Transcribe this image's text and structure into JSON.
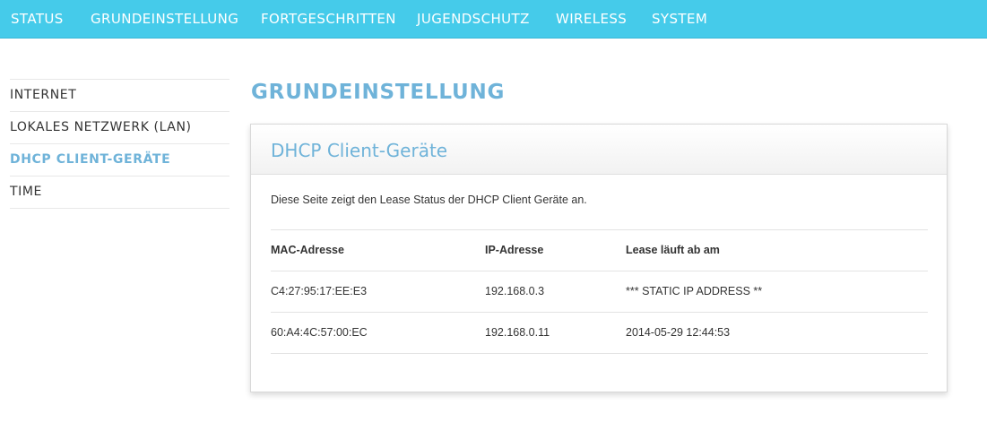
{
  "topnav": {
    "items": [
      "STATUS",
      "GRUNDEINSTELLUNG",
      "FORTGESCHRITTEN",
      "JUGENDSCHUTZ",
      "WIRELESS",
      "SYSTEM"
    ],
    "background": "#45cbea"
  },
  "sidebar": {
    "items": [
      {
        "label": "INTERNET"
      },
      {
        "label": "LOKALES NETZWERK (LAN)"
      },
      {
        "label": "DHCP CLIENT-GERÄTE",
        "active": true
      },
      {
        "label": "TIME"
      }
    ]
  },
  "page": {
    "title": "GRUNDEINSTELLUNG"
  },
  "panel": {
    "title": "DHCP Client-Geräte",
    "description": "Diese Seite zeigt den Lease Status der DHCP Client Geräte an.",
    "table": {
      "headers": [
        "MAC-Adresse",
        "IP-Adresse",
        "Lease läuft ab am"
      ],
      "rows": [
        [
          "C4:27:95:17:EE:E3",
          "192.168.0.3",
          "*** STATIC IP ADDRESS **"
        ],
        [
          "60:A4:4C:57:00:EC",
          "192.168.0.11",
          "2014-05-29 12:44:53"
        ]
      ]
    }
  },
  "colors": {
    "accent": "#6fb3d9",
    "nav_bg": "#45cbea"
  }
}
